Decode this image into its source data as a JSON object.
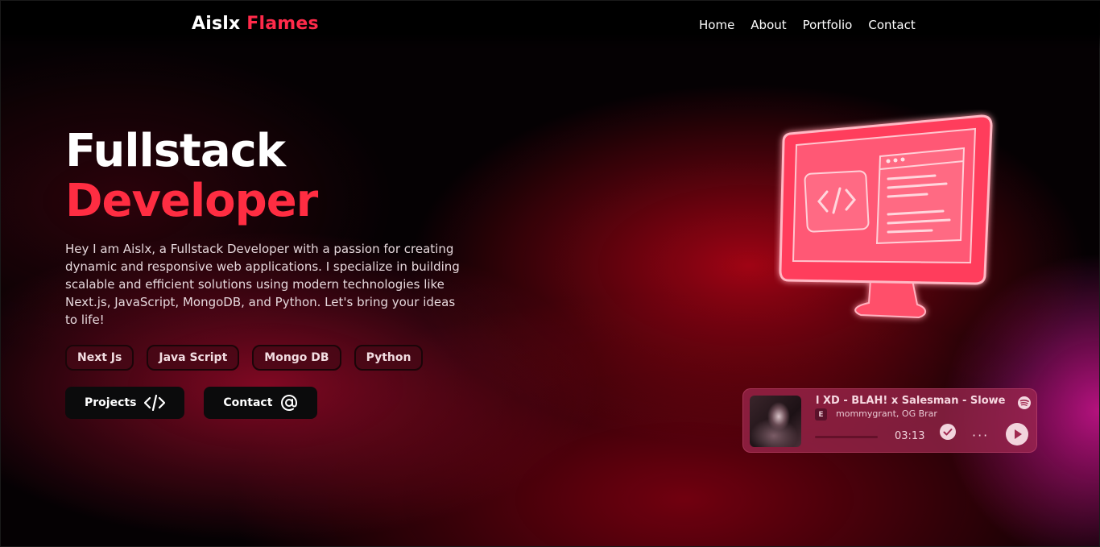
{
  "nav": {
    "brand_first": "Aislx",
    "brand_second": "Flames",
    "links": [
      "Home",
      "About",
      "Portfolio",
      "Contact"
    ]
  },
  "hero": {
    "title_line1": "Fullstack",
    "title_line2": "Developer",
    "intro": "Hey I am Aislx, a Fullstack Developer with a passion for creating dynamic and responsive web applications. I specialize in building scalable and efficient solutions using modern technologies like Next.js, JavaScript, MongoDB, and Python. Let's bring your ideas to life!",
    "tags": [
      "Next Js",
      "Java Script",
      "Mongo DB",
      "Python"
    ],
    "buttons": {
      "projects": "Projects",
      "contact": "Contact"
    }
  },
  "icons": {
    "projects": "code-icon",
    "contact": "at-sign-icon",
    "illustration": "monitor-code-icon",
    "player_brand": "spotify-icon",
    "saved": "check-circle-icon",
    "more": "more-dots-icon",
    "play": "play-icon"
  },
  "player": {
    "track": "l XD - BLAH! x Salesman - Slowed + R",
    "explicit": "E",
    "artist": "mommygrant, OG Brar",
    "time": "03:13",
    "more": "···",
    "progress": 0
  },
  "colors": {
    "accent": "#ff2d42",
    "background": "#050103",
    "button_dark": "#0b0b0c",
    "player_bg": "#a02850"
  }
}
